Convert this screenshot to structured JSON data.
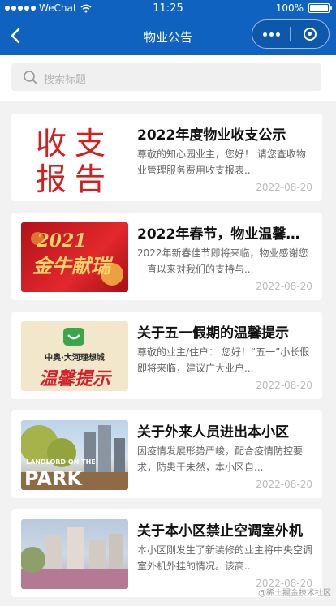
{
  "status": {
    "carrier": "WeChat",
    "time": "11:25",
    "battery": "100%"
  },
  "nav": {
    "title": "物业公告"
  },
  "search": {
    "placeholder": "搜索标题"
  },
  "notices": [
    {
      "title": "2022年度物业收支公示",
      "desc": "尊敬的知心园业主，您好！ 请您查收物业管理服务费用收支报表...",
      "date": "2022-08-20",
      "thumb_text": [
        "收支",
        "报告"
      ]
    },
    {
      "title": "2022年春节，物业温馨提示",
      "desc": "2022年新春佳节即将来临，物业感谢您一直以来对我们的支持与...",
      "date": "2022-08-20",
      "thumb_text": [
        "2021",
        "金牛献瑞"
      ]
    },
    {
      "title": "关于五一假期的温馨提示",
      "desc": "尊敬的业主/住户： 您好！“五一”小长假即将来临，建议广大业户...",
      "date": "2022-08-20",
      "thumb_text": [
        "中奥·大河理想城",
        "温馨提示"
      ]
    },
    {
      "title": "关于外来人员进出本小区",
      "desc": "因疫情发展形势严峻，配合疫情防控要求，防患于未然，本小区自...",
      "date": "2022-08-20",
      "thumb_text": [
        "LANDLORD ON THE",
        "PARK"
      ]
    },
    {
      "title": "关于本小区禁止空调室外机",
      "desc": "本小区刚发生了新装修的业主将中央空调室外机外挂的情况。该高...",
      "date": "2022-08-20",
      "thumb_text": []
    }
  ],
  "watermark": "@稀土掘金技术社区",
  "colors": {
    "brand": "#1062c0",
    "bg": "#f2f2f2"
  }
}
